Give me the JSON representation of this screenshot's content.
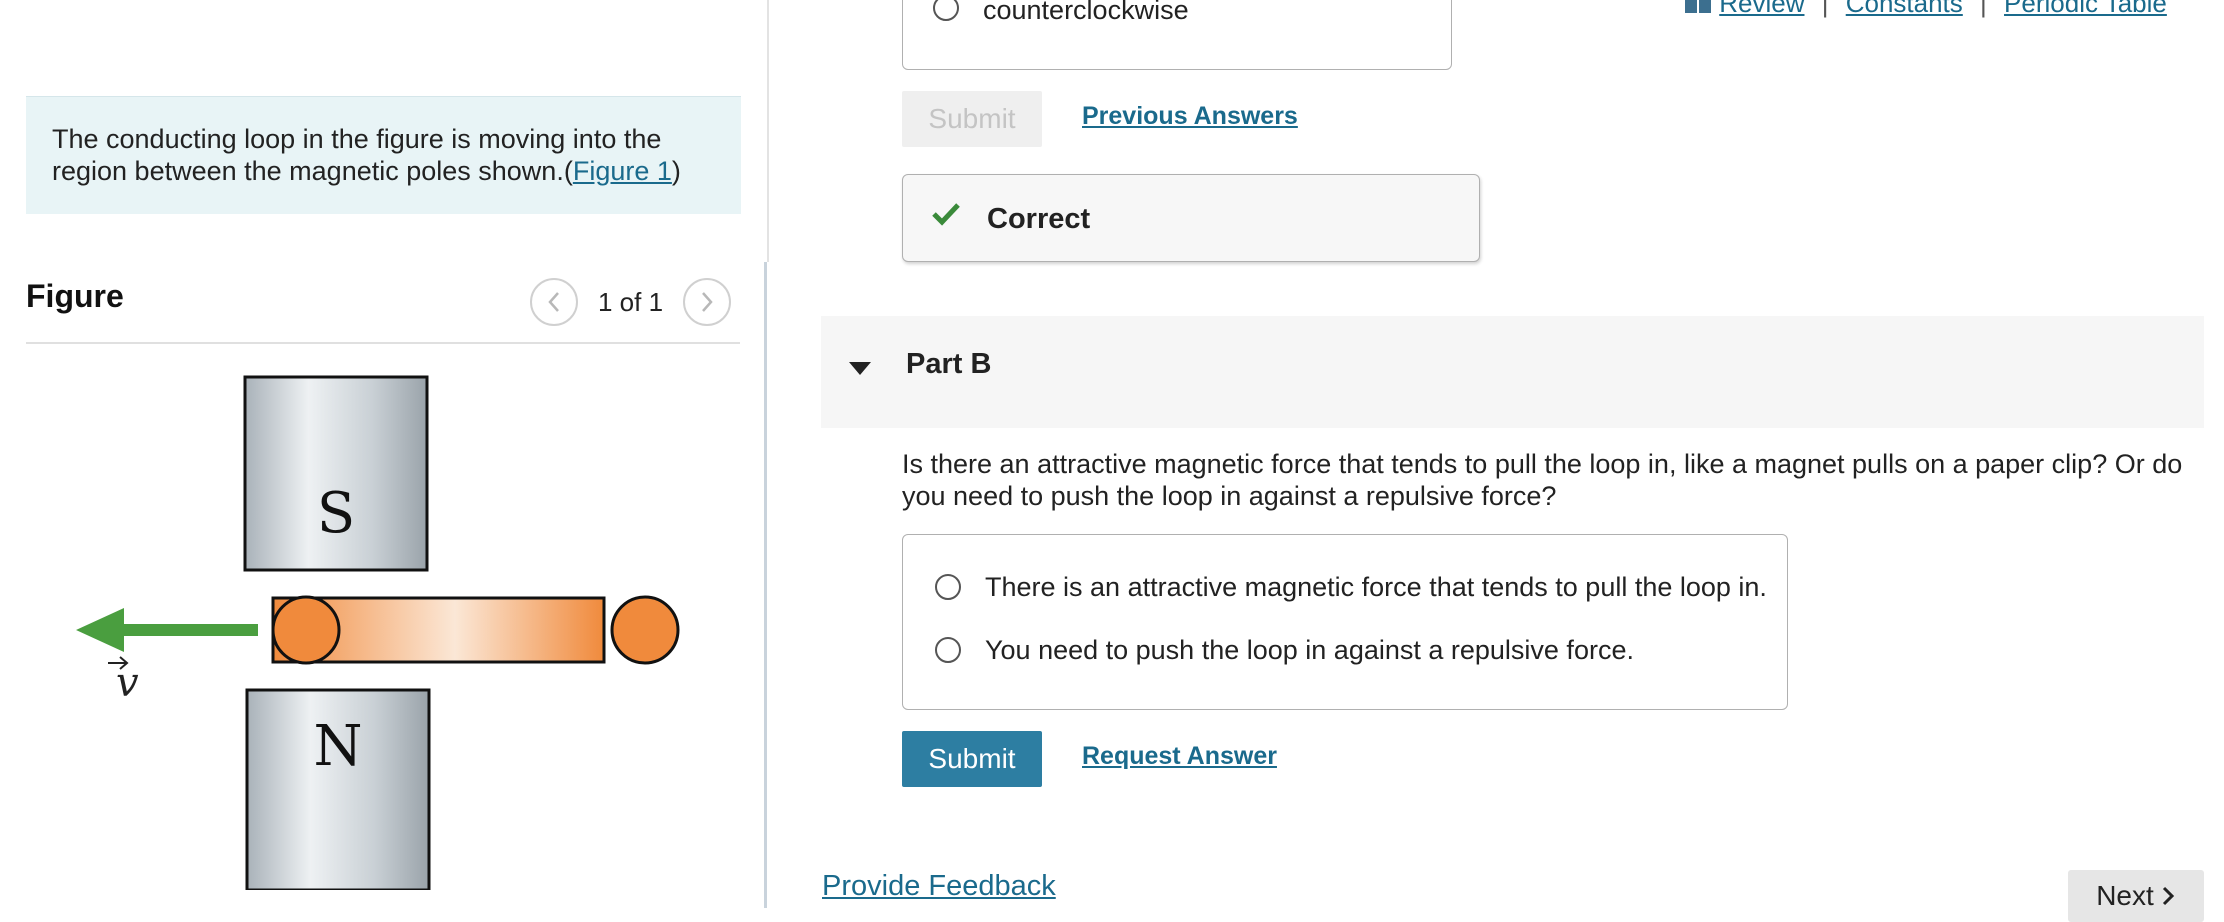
{
  "prompt": {
    "text": "The conducting loop in the figure is moving into the region between the magnetic poles shown.(",
    "figure_link": "Figure 1",
    "close": ")"
  },
  "figure": {
    "title": "Figure",
    "page_count": "1 of 1",
    "prev_icon": "chevron-left-icon",
    "next_icon": "chevron-right-icon",
    "labels": {
      "south": "S",
      "north": "N",
      "velocity": "v"
    },
    "colors": {
      "arrow": "#4a9e3f",
      "loop": "#f08a3c",
      "magnet": "#cfd5da"
    }
  },
  "top_links": {
    "review": "Review",
    "constants": "Constants",
    "periodic_table": "Periodic Table",
    "separator": "|"
  },
  "part_a": {
    "visible_option": "counterclockwise",
    "submit_label": "Submit",
    "previous_answers_label": "Previous Answers",
    "result_label": "Correct",
    "result_icon": "checkmark-icon",
    "result_color": "#3a8a3a"
  },
  "part_b": {
    "title": "Part B",
    "question": "Is there an attractive magnetic force that tends to pull the loop in, like a magnet pulls on a paper clip? Or do you need to push the loop in against a repulsive force?",
    "options": [
      "There is an attractive magnetic force that tends to pull the loop in.",
      "You need to push the loop in against a repulsive force."
    ],
    "submit_label": "Submit",
    "request_answer_label": "Request Answer",
    "submit_color": "#2d7ea2"
  },
  "footer": {
    "feedback_label": "Provide Feedback",
    "next_label": "Next"
  }
}
